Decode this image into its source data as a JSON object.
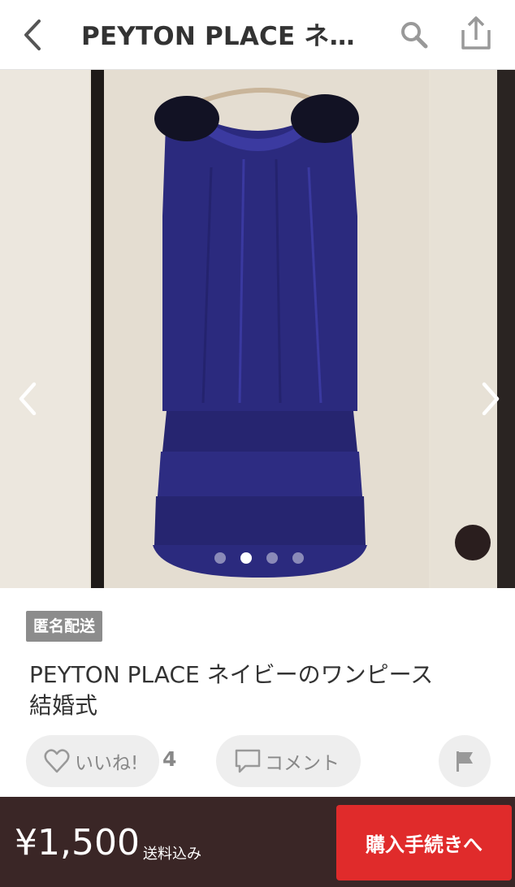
{
  "header": {
    "title": "PEYTON PLACE ネ…",
    "back_icon": "chevron-left-icon",
    "search_icon": "search-icon",
    "share_icon": "share-icon"
  },
  "carousel": {
    "prev_icon": "chevron-left-icon",
    "next_icon": "chevron-right-icon",
    "page_count": 4,
    "active_index": 1
  },
  "item": {
    "badge": "匿名配送",
    "title": "PEYTON PLACE ネイビーのワンピース\n結婚式"
  },
  "actions": {
    "like_label": "いいね!",
    "like_count": "4",
    "comment_label": "コメント",
    "report_icon": "flag-icon"
  },
  "footer": {
    "price": "¥1,500",
    "price_note": "送料込み",
    "buy_label": "購入手続きへ"
  },
  "colors": {
    "buy_button": "#e02b2b",
    "footer_bg": "#3a2626",
    "badge_bg": "#8c8c8c",
    "dress": "#2a2a7a"
  }
}
